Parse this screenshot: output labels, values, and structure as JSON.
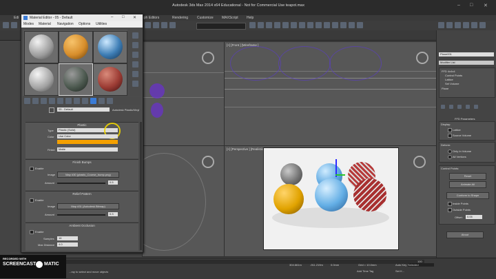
{
  "app_title": "Autodesk 3ds Max 2014 x64   Educational - Not for Commercial Use    teapot.max",
  "menubar": [
    "Edi",
    "aph Editors",
    "Rendering",
    "Customize",
    "MAXScript",
    "Help"
  ],
  "material_editor": {
    "title": "Material Editor - 05 - Default",
    "menus": [
      "Modes",
      "Material",
      "Navigation",
      "Options",
      "Utilities"
    ],
    "material_name": "05 - Default",
    "material_type": "Autodesk Plastic/Vinyl",
    "plastic": {
      "title": "Plastic",
      "type_label": "Type",
      "type_value": "Plastic (Solid)",
      "color_label": "Color",
      "color_value": "Use Color",
      "finish_label": "Finish",
      "finish_value": "Matte"
    },
    "finish_bumps": {
      "title": "Finish Bumps",
      "enable": "Enable",
      "image_label": "Image",
      "image_value": "Map #30 (plastic_Course_bump.png)",
      "amount_label": "Amount",
      "amount_value": "0.5"
    },
    "relief_pattern": {
      "title": "Relief Pattern",
      "enable": "Enable",
      "image_label": "Image",
      "image_value": "Map #31 (Autodesk Bitmap)",
      "amount_label": "Amount",
      "amount_value": "0.3"
    },
    "ambient_occlusion": {
      "title": "Ambient Occlusion",
      "enable": "Enable",
      "samples_label": "Samples",
      "samples_value": "16",
      "max_distance_label": "Max Distance",
      "max_distance_value": "4.0"
    }
  },
  "viewports": {
    "front_label": "[+] [Front ] [Wireframe ]",
    "perspective_label": "[+] [Perspective ] [Realistic ]"
  },
  "command_panel": {
    "object_name": "Plane001",
    "modifier_list": "Modifier List",
    "stack": [
      "FFD 4x4x4",
      "Control Points",
      "Lattice",
      "Set Volume",
      "Plane"
    ],
    "ffd_title": "FFD Parameters",
    "display_label": "Display:",
    "lattice": "Lattice",
    "source_volume": "Source Volume",
    "deform_label": "Deform:",
    "only_in_volume": "Only In Volume",
    "all_vertices": "All Vertices",
    "control_points_label": "Control Points:",
    "reset": "Reset",
    "animate_all": "Animate All",
    "conform_to_shape": "Conform to Shape",
    "inside_points": "Inside Points",
    "outside_points": "Outside Points",
    "offset_label": "Offset:",
    "offset_value": "0.05",
    "about": "About"
  },
  "status": {
    "recorded_line1": "RECORDED WITH",
    "recorded_line2": "SCREENCAST",
    "recorded_line3": "MATIC",
    "hint": "...ray to select and move objects",
    "x_val": "304.661m",
    "y_val": "-911.219m",
    "z_val": "0.0mm",
    "grid": "Grid = 10.0mm",
    "auto_key": "Auto Key",
    "selected": "Selected",
    "set_key": "Set K...",
    "add_time_tag": "Add Time Tag",
    "frame": "100"
  }
}
